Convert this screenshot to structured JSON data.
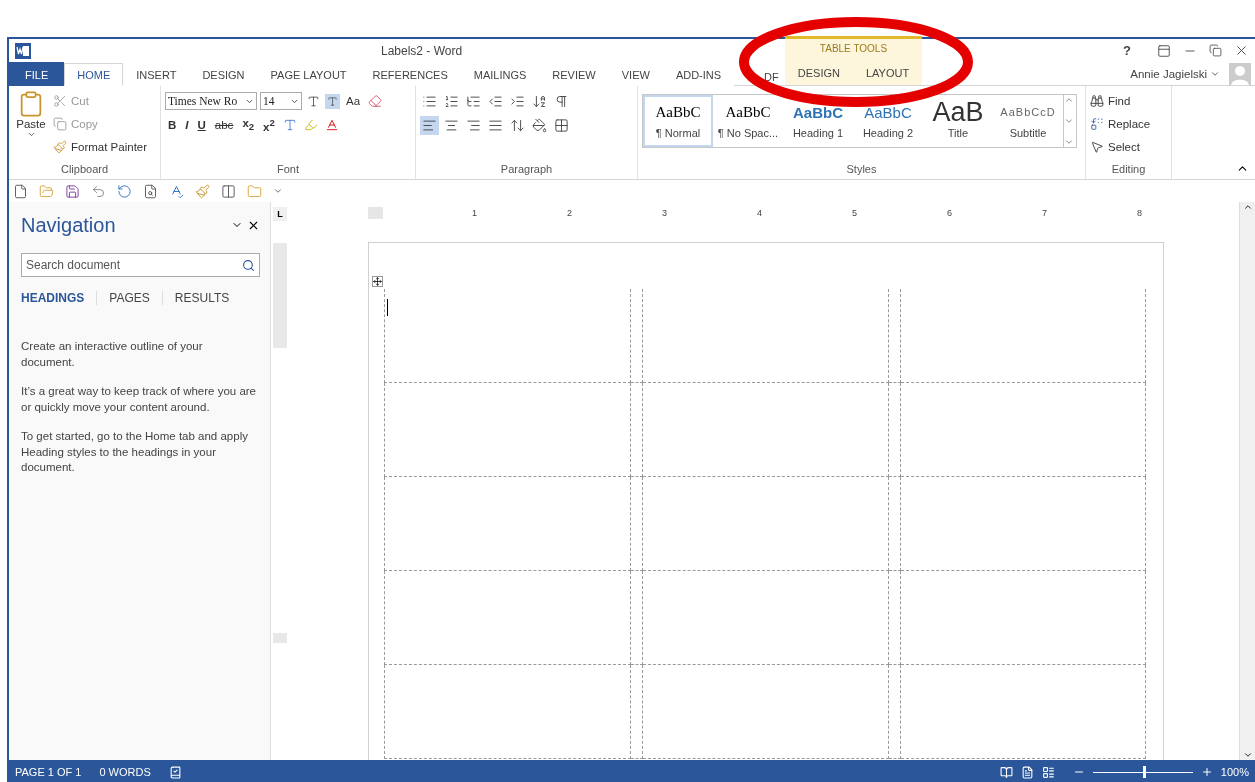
{
  "window": {
    "title": "Labels2 - Word",
    "help": "?",
    "user": "Annie Jagielski"
  },
  "tabs": [
    {
      "label": "FILE",
      "kind": "file",
      "selected": false
    },
    {
      "label": "HOME",
      "kind": "tab",
      "selected": true
    },
    {
      "label": "INSERT",
      "kind": "tab",
      "selected": false
    },
    {
      "label": "DESIGN",
      "kind": "tab",
      "selected": false
    },
    {
      "label": "PAGE LAYOUT",
      "kind": "tab",
      "selected": false
    },
    {
      "label": "REFERENCES",
      "kind": "tab",
      "selected": false
    },
    {
      "label": "MAILINGS",
      "kind": "tab",
      "selected": false
    },
    {
      "label": "REVIEW",
      "kind": "tab",
      "selected": false
    },
    {
      "label": "VIEW",
      "kind": "tab",
      "selected": false
    },
    {
      "label": "ADD-INS",
      "kind": "tab",
      "selected": false
    },
    {
      "label": "DF",
      "kind": "tab",
      "selected": false
    }
  ],
  "contextual": {
    "title": "TABLE TOOLS",
    "tabs": [
      {
        "label": "DESIGN",
        "selected": false
      },
      {
        "label": "LAYOUT",
        "selected": false
      }
    ]
  },
  "clipboard": {
    "label": "Clipboard",
    "paste": "Paste",
    "items": [
      {
        "label": "Cut",
        "disabled": true
      },
      {
        "label": "Copy",
        "disabled": true
      },
      {
        "label": "Format Painter",
        "disabled": false
      }
    ]
  },
  "font": {
    "label": "Font",
    "name": "Times New Ro",
    "size": "14",
    "case": "Aa",
    "format_buttons": [
      "B",
      "I",
      "U",
      "abc",
      "x$_{2}$",
      "x$^{2}$"
    ]
  },
  "paragraph": {
    "label": "Paragraph"
  },
  "styles": {
    "label": "Styles",
    "items": [
      {
        "sample": "AaBbC",
        "name": "¶ Normal",
        "kind": "normal",
        "selected": true
      },
      {
        "sample": "AaBbC",
        "name": "¶ No Spac...",
        "kind": "normal",
        "selected": false
      },
      {
        "sample": "AaBbC",
        "name": "Heading 1",
        "kind": "heading1",
        "selected": false
      },
      {
        "sample": "AaBbC",
        "name": "Heading 2",
        "kind": "heading2",
        "selected": false
      },
      {
        "sample": "AaB",
        "name": "Title",
        "kind": "title",
        "selected": false
      },
      {
        "sample": "AaBbCcD",
        "name": "Subtitle",
        "kind": "subtitle",
        "selected": false
      }
    ]
  },
  "editing": {
    "label": "Editing",
    "items": [
      "Find",
      "Replace",
      "Select"
    ]
  },
  "navigation": {
    "title": "Navigation",
    "search": {
      "placeholder": "Search document"
    },
    "tabs": [
      {
        "label": "HEADINGS",
        "selected": true
      },
      {
        "label": "PAGES",
        "selected": false
      },
      {
        "label": "RESULTS",
        "selected": false
      }
    ],
    "paragraphs": [
      "Create an interactive outline of your document.",
      "It’s a great way to keep track of where you are or quickly move your content around.",
      "To get started, go to the Home tab and apply Heading styles to the headings in your document."
    ]
  },
  "tab_selector": "L",
  "ruler": [
    "1",
    "2",
    "3",
    "4",
    "5",
    "6",
    "7",
    "8"
  ],
  "status_bar": {
    "page": "PAGE 1 OF 1",
    "words": "0 WORDS",
    "zoom": {
      "level": 0.5,
      "reading": "100%"
    }
  }
}
